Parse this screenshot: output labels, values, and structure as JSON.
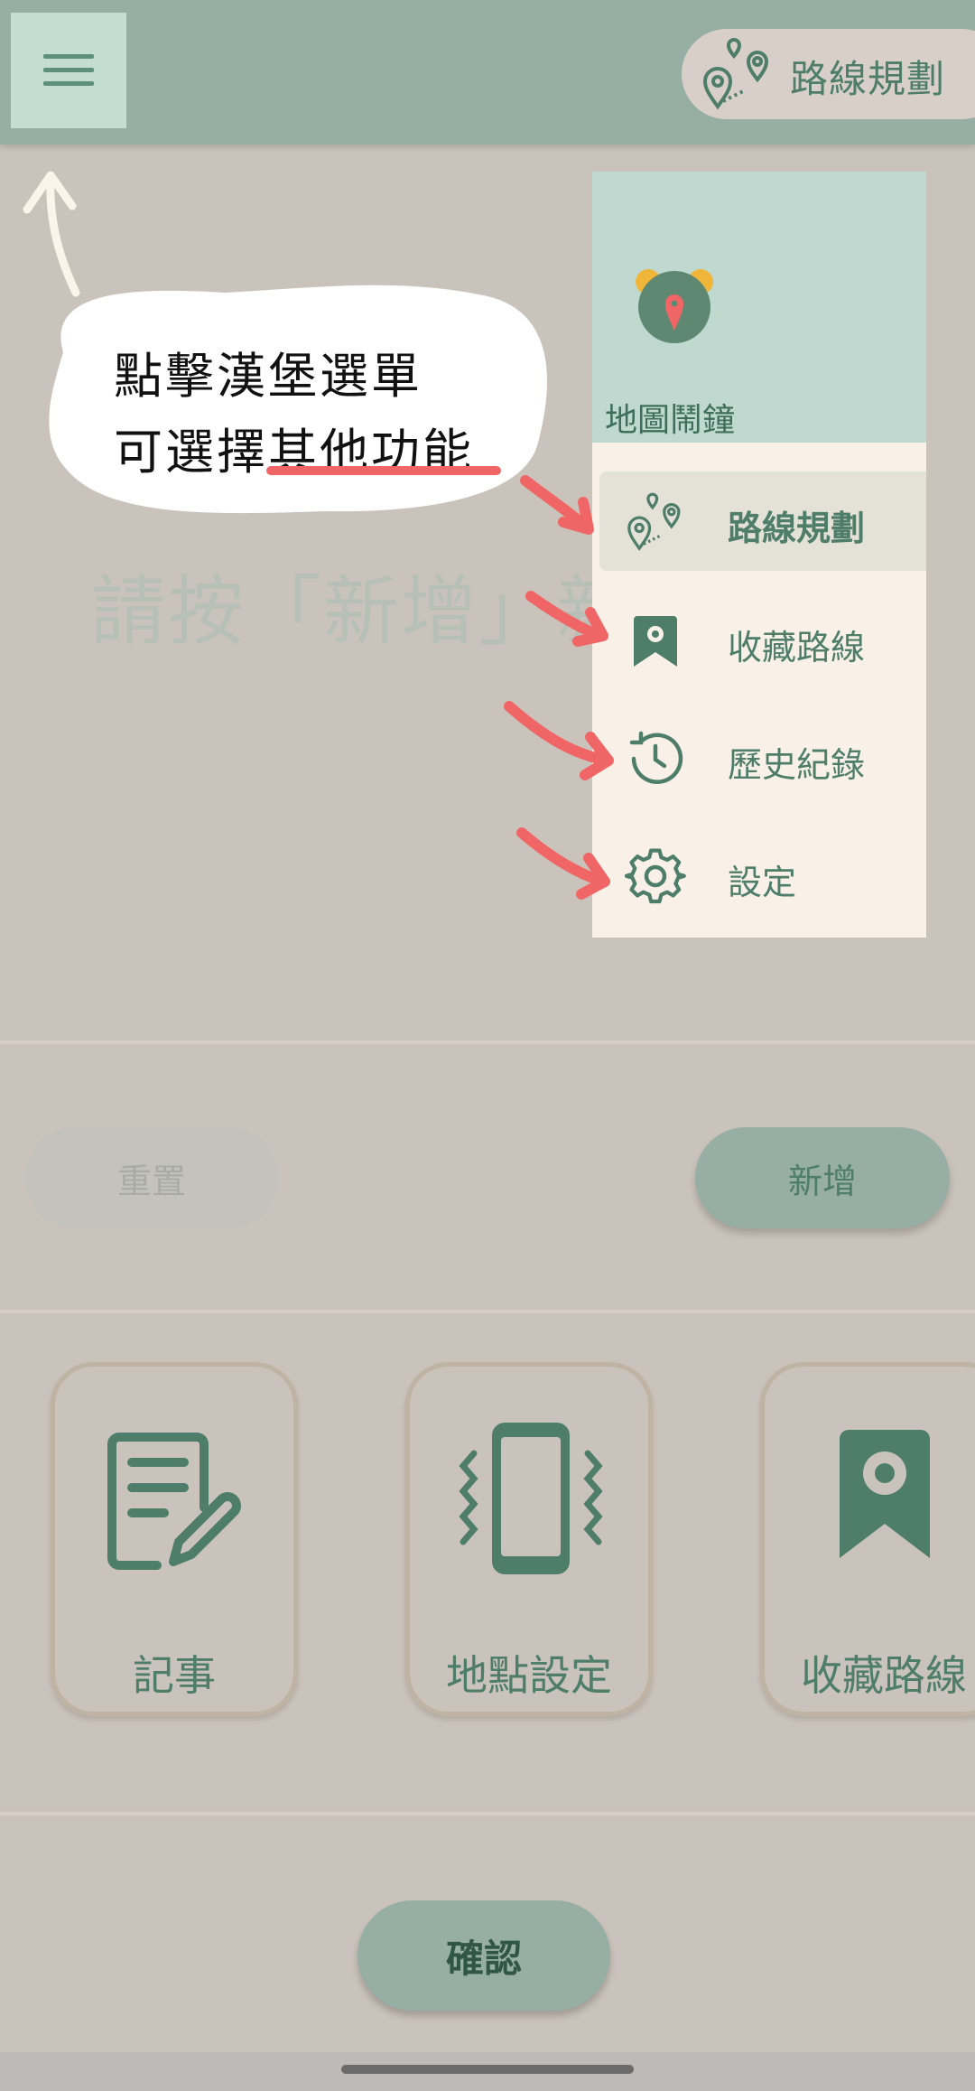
{
  "header": {
    "menu_icon": "hamburger-menu-icon",
    "route_chip_icon": "map-pins-route-icon",
    "route_chip_label": "路線規劃"
  },
  "main": {
    "hint_text": "請按「新增」新"
  },
  "annotation": {
    "line1": "點擊漢堡選單",
    "line2": "可選擇其他功能",
    "arrow_color": "#f06666"
  },
  "drawer": {
    "logo_icon": "alarm-map-pin-icon",
    "title": "地圖鬧鐘",
    "items": [
      {
        "label": "路線規劃",
        "icon": "map-pins-route-icon",
        "active": true
      },
      {
        "label": "收藏路線",
        "icon": "bookmark-pin-icon",
        "active": false
      },
      {
        "label": "歷史紀錄",
        "icon": "history-clock-icon",
        "active": false
      },
      {
        "label": "設定",
        "icon": "gear-icon",
        "active": false
      }
    ]
  },
  "actions": {
    "reset_label": "重置",
    "add_label": "新增"
  },
  "cards": [
    {
      "label": "記事",
      "icon": "note-pencil-icon"
    },
    {
      "label": "地點設定",
      "icon": "phone-vibrate-icon"
    },
    {
      "label": "收藏路線",
      "icon": "bookmark-pin-icon"
    }
  ],
  "footer": {
    "confirm_label": "確認"
  },
  "colors": {
    "primary": "#97aea5",
    "accent_green": "#4e7e6a",
    "background": "#cac3bb",
    "drawer_bg": "#f9f1e8",
    "drawer_header": "#bfd9d0",
    "marker_red": "#f06666"
  }
}
